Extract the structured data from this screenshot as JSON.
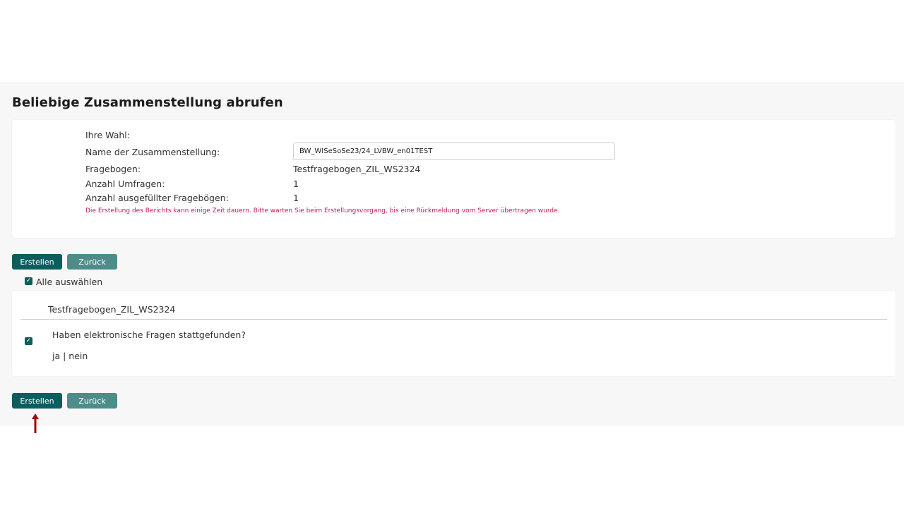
{
  "page": {
    "title": "Beliebige Zusammenstellung abrufen"
  },
  "info": {
    "choice_label": "Ihre Wahl:",
    "name_label": "Name der Zusammenstellung:",
    "name_value": "BW_WISeSoSe23/24_LVBW_en01TEST",
    "questionnaire_label": "Fragebogen:",
    "questionnaire_value": "Testfragebogen_ZIL_WS2324",
    "surveys_label": "Anzahl Umfragen:",
    "surveys_value": "1",
    "filled_label": "Anzahl ausgefüllter Fragebögen:",
    "filled_value": "1",
    "note": "Die Erstellung des Berichts kann einige Zeit dauern. Bitte warten Sie beim Erstellungsvorgang, bis eine Rückmeldung vom Server übertragen wurde."
  },
  "actions_top": {
    "create_label": "Erstellen",
    "back_label": "Zurück"
  },
  "select_all": {
    "label": "Alle auswählen",
    "checked": true
  },
  "questions": {
    "header": "Testfragebogen_ZIL_WS2324",
    "items": [
      {
        "text": "Haben elektronische Fragen stattgefunden?",
        "answers": "ja | nein",
        "checked": true
      }
    ]
  },
  "actions_bottom": {
    "create_label": "Erstellen",
    "back_label": "Zurück"
  },
  "colors": {
    "primary": "#0b5d5e",
    "secondary": "#4e8c8a",
    "note": "#c2185b",
    "arrow": "#9b0a0a"
  },
  "icons": {
    "checkbox": "checkmark-icon",
    "pointer": "arrow-up-icon"
  }
}
